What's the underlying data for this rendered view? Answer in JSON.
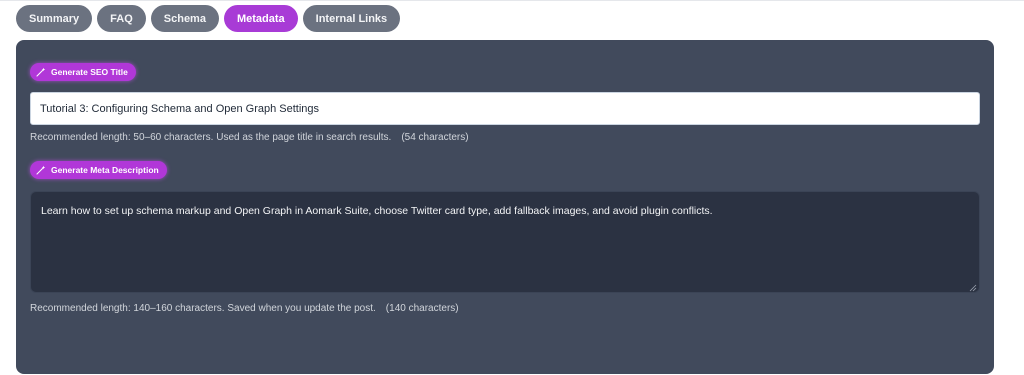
{
  "tabs": [
    {
      "label": "Summary",
      "active": false
    },
    {
      "label": "FAQ",
      "active": false
    },
    {
      "label": "Schema",
      "active": false
    },
    {
      "label": "Metadata",
      "active": true
    },
    {
      "label": "Internal Links",
      "active": false
    }
  ],
  "metadata": {
    "seo_title_button": "Generate SEO Title",
    "seo_title_value": "Tutorial 3: Configuring Schema and Open Graph Settings",
    "seo_title_hint": "Recommended length: 50–60 characters. Used as the page title in search results.",
    "seo_title_count": "(54 characters)",
    "meta_desc_button": "Generate Meta Description",
    "meta_desc_value": "Learn how to set up schema markup and Open Graph in Aomark Suite, choose Twitter card type, add fallback images, and avoid plugin conflicts.",
    "meta_desc_hint": "Recommended length: 140–160 characters. Saved when you update the post.",
    "meta_desc_count": "(140 characters)"
  },
  "icons": {
    "generate": "magic-wand-icon"
  },
  "colors": {
    "tab_inactive": "#6b7280",
    "tab_active": "#a83bd6",
    "panel_bg": "#414a5c",
    "textarea_bg": "#2b3242",
    "button_accent": "#b137d8"
  }
}
